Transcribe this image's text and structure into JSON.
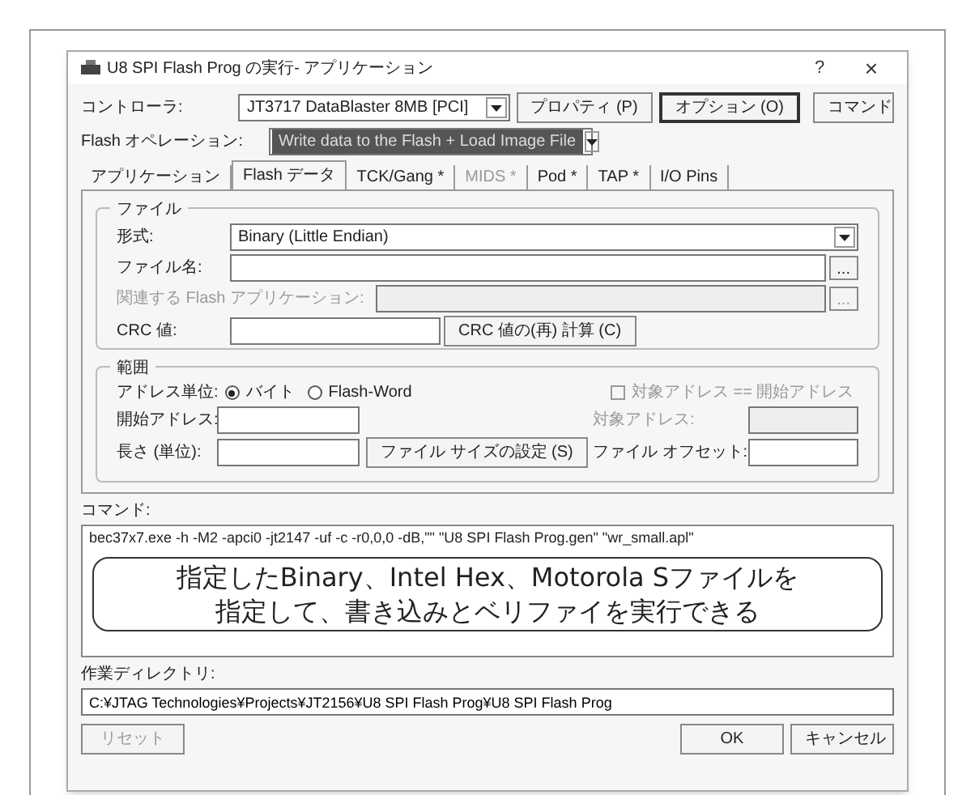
{
  "window": {
    "title": "U8 SPI Flash Prog の実行- アプリケーション",
    "help": "?",
    "close": "×"
  },
  "controller": {
    "label": "コントローラ:",
    "value": "JT3717 DataBlaster 8MB [PCI]"
  },
  "top_buttons": [
    {
      "label": "プロパティ (P)",
      "default": false
    },
    {
      "label": "オプション (O)",
      "default": true
    },
    {
      "label": "コマンド",
      "default": false
    }
  ],
  "flash_operation": {
    "label": "Flash オペレーション:",
    "value": "Write data to the Flash + Load Image File",
    "highlighted": true
  },
  "tabs": [
    {
      "label": "アプリケーション",
      "selected": false,
      "disabled": false
    },
    {
      "label": "Flash データ",
      "selected": true,
      "disabled": false
    },
    {
      "label": "TCK/Gang *",
      "selected": false,
      "disabled": false
    },
    {
      "label": "MIDS *",
      "selected": false,
      "disabled": true
    },
    {
      "label": "Pod *",
      "selected": false,
      "disabled": false
    },
    {
      "label": "TAP *",
      "selected": false,
      "disabled": false
    },
    {
      "label": "I/O Pins",
      "selected": false,
      "disabled": false
    }
  ],
  "file_group": {
    "title": "ファイル",
    "format": {
      "label": "形式:",
      "value": "Binary (Little Endian)"
    },
    "filename": {
      "label": "ファイル名:",
      "browse": "..."
    },
    "related_app": {
      "label": "関連する Flash アプリケーション:",
      "disabled": true,
      "browse": "..."
    },
    "crc": {
      "label": "CRC 値:",
      "button": "CRC 値の(再) 計算 (C)"
    }
  },
  "range_group": {
    "title": "範囲",
    "address_unit": {
      "label": "アドレス単位:",
      "options": [
        {
          "label": "バイト",
          "selected": true
        },
        {
          "label": "Flash-Word",
          "selected": false
        }
      ]
    },
    "target_same": {
      "label": "対象アドレス == 開始アドレス",
      "checked": false,
      "disabled": true
    },
    "start_address": {
      "label": "開始アドレス:"
    },
    "target_address": {
      "label": "対象アドレス:",
      "disabled": true
    },
    "length": {
      "label": "長さ (単位):"
    },
    "file_size_button": "ファイル サイズの設定 (S)",
    "file_offset": {
      "label": "ファイル オフセット:"
    }
  },
  "command": {
    "label": "コマンド:",
    "value": "bec37x7.exe -h -M2 -apci0 -jt2147 -uf -c -r0,0,0 -dB,\"\" \"U8 SPI Flash Prog.gen\" \"wr_small.apl\""
  },
  "callout": [
    "指定したBinary、Intel Hex、Motorola Sファイルを",
    "指定して、書き込みとベリファイを実行できる"
  ],
  "working_dir": {
    "label": "作業ディレクトリ:",
    "value": "C:¥JTAG Technologies¥Projects¥JT2156¥U8 SPI Flash Prog¥U8 SPI Flash Prog"
  },
  "bottom_buttons": [
    {
      "label": "リセット",
      "disabled": true
    },
    {
      "label": "OK",
      "disabled": false
    },
    {
      "label": "キャンセル",
      "disabled": false
    }
  ]
}
